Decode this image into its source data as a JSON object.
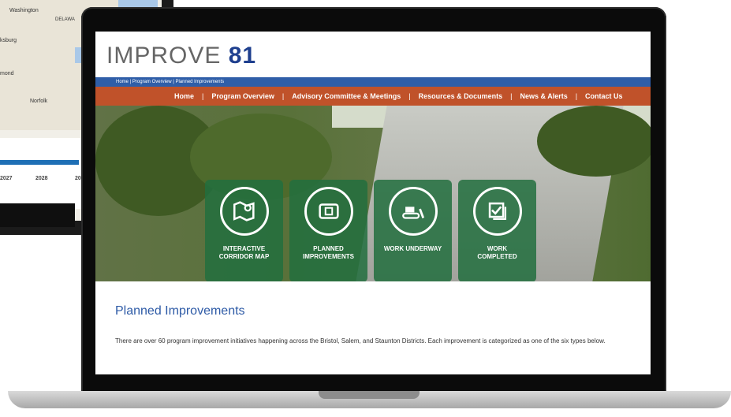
{
  "background_device": {
    "map_labels": [
      "Washington",
      "DELAWA",
      "ksburg",
      "mond",
      "Norfolk"
    ],
    "chart_ticks": [
      "2027",
      "2028",
      "20"
    ],
    "bar_color": "#1e6fb5"
  },
  "site": {
    "brand_text": "IMPROVE",
    "brand_number": "81",
    "breadcrumb": "Home | Program Overview | Planned Improvements",
    "nav": [
      "Home",
      "Program Overview",
      "Advisory Committee & Meetings",
      "Resources & Documents",
      "News & Alerts",
      "Contact Us"
    ],
    "nav_separator": "|",
    "tiles": [
      {
        "label": "INTERACTIVE\nCORRIDOR MAP",
        "icon": "map-icon"
      },
      {
        "label": "PLANNED\nIMPROVEMENTS",
        "icon": "blueprint-icon"
      },
      {
        "label": "WORK UNDERWAY",
        "icon": "bulldozer-icon"
      },
      {
        "label": "WORK\nCOMPLETED",
        "icon": "checklist-icon"
      }
    ],
    "section_title": "Planned Improvements",
    "section_text": "There are over 60 program improvement initiatives happening across the Bristol, Salem, and Staunton Districts. Each improvement is categorized as one of the six types below."
  },
  "colors": {
    "brand_blue": "#1e3f8e",
    "nav_orange": "#c0522a",
    "crumb_blue": "#2f5ea8",
    "tile_green": "#226f3e"
  }
}
